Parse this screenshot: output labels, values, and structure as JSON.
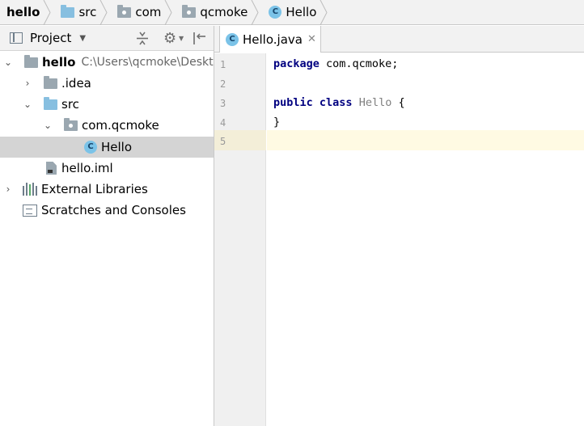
{
  "breadcrumb": {
    "items": [
      "hello",
      "src",
      "com",
      "qcmoke",
      "Hello"
    ]
  },
  "project_panel": {
    "title": "Project",
    "tree": [
      {
        "label": "hello",
        "path": "C:\\Users\\qcmoke\\Deskt"
      },
      {
        "label": ".idea"
      },
      {
        "label": "src"
      },
      {
        "label": "com.qcmoke"
      },
      {
        "label": "Hello",
        "selected": true
      },
      {
        "label": "hello.iml"
      },
      {
        "label": "External Libraries"
      },
      {
        "label": "Scratches and Consoles"
      }
    ]
  },
  "editor": {
    "tab_label": "Hello.java",
    "class_icon_letter": "C",
    "line_numbers": [
      "1",
      "2",
      "3",
      "4",
      "5"
    ],
    "code": {
      "line1_keyword": "package",
      "line1_rest": " com.qcmoke;",
      "line3_kw1": "public",
      "line3_kw2": "class",
      "line3_name": "Hello",
      "line3_brace": " {",
      "line4": "}"
    },
    "current_line": 5
  },
  "colors": {
    "keyword": "#000080",
    "class_name": "#808080",
    "caret_line": "#fffae3",
    "selection": "#d4d4d4"
  },
  "icons": [
    "folder-icon",
    "package-icon",
    "class-icon",
    "project-pane-icon",
    "locate-icon",
    "collapse-icon",
    "gear-icon",
    "hide-icon",
    "chevron-right-icon",
    "chevron-down-icon",
    "module-file-icon",
    "libraries-icon",
    "scratches-icon",
    "close-icon"
  ]
}
